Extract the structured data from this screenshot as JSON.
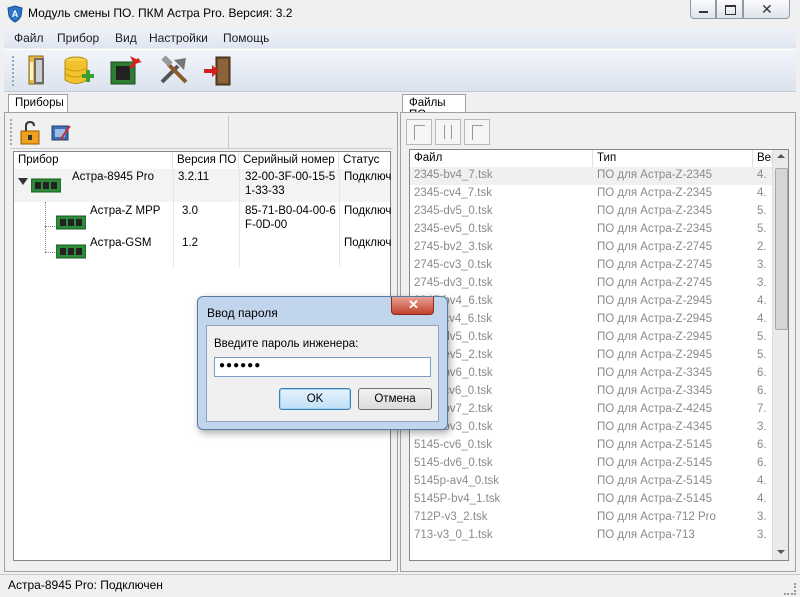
{
  "window": {
    "title": "Модуль смены ПО. ПКМ Астра Pro. Версия: 3.2"
  },
  "menu": [
    "Файл",
    "Прибор",
    "Вид",
    "Настройки",
    "Помощь"
  ],
  "toolbar": {
    "icons": [
      "open-folder-icon",
      "add-database-icon",
      "chip-download-icon",
      "tools-icon",
      "exit-icon"
    ]
  },
  "left_panel": {
    "tab": "Приборы",
    "icons": [
      "lock-icon",
      "chip-pencil-icon"
    ],
    "columns": [
      "Прибор",
      "Версия ПО",
      "Серийный номер",
      "Статус"
    ],
    "devices": [
      {
        "name": "Астра-8945 Pro",
        "version": "3.2.11",
        "serial_l1": "32-00-3F-00-15-5",
        "serial_l2": "1-33-33",
        "status": "Подключ"
      },
      {
        "name": "Астра-Z МРР",
        "version": "3.0",
        "serial_l1": "85-71-B0-04-00-6",
        "serial_l2": "F-0D-00",
        "status": "Подключ"
      },
      {
        "name": "Астра-GSM",
        "version": "1.2",
        "serial_l1": "",
        "serial_l2": "",
        "status": "Подключ"
      }
    ]
  },
  "right_panel": {
    "tab": "Файлы ПО",
    "columns": [
      "Файл",
      "Тип",
      "Верси"
    ],
    "files": [
      {
        "file": "2345-bv4_7.tsk",
        "type": "ПО для Астра-Z-2345",
        "ver": "4."
      },
      {
        "file": "2345-cv4_7.tsk",
        "type": "ПО для Астра-Z-2345",
        "ver": "4."
      },
      {
        "file": "2345-dv5_0.tsk",
        "type": "ПО для Астра-Z-2345",
        "ver": "5."
      },
      {
        "file": "2345-ev5_0.tsk",
        "type": "ПО для Астра-Z-2345",
        "ver": "5."
      },
      {
        "file": "2745-bv2_3.tsk",
        "type": "ПО для Астра-Z-2745",
        "ver": "2."
      },
      {
        "file": "2745-cv3_0.tsk",
        "type": "ПО для Астра-Z-2745",
        "ver": "3."
      },
      {
        "file": "2745-dv3_0.tsk",
        "type": "ПО для Астра-Z-2745",
        "ver": "3."
      },
      {
        "file": "2945-bv4_6.tsk",
        "type": "ПО для Астра-Z-2945",
        "ver": "4."
      },
      {
        "file": "2945-cv4_6.tsk",
        "type": "ПО для Астра-Z-2945",
        "ver": "4."
      },
      {
        "file": "2945-dv5_0.tsk",
        "type": "ПО для Астра-Z-2945",
        "ver": "5."
      },
      {
        "file": "2945-ev5_2.tsk",
        "type": "ПО для Астра-Z-2945",
        "ver": "5."
      },
      {
        "file": "3345-bv6_0.tsk",
        "type": "ПО для Астра-Z-3345",
        "ver": "6."
      },
      {
        "file": "3345-cv6_0.tsk",
        "type": "ПО для Астра-Z-3345",
        "ver": "6."
      },
      {
        "file": "4245-bv7_2.tsk",
        "type": "ПО для Астра-Z-4245",
        "ver": "7."
      },
      {
        "file": "4345-bv3_0.tsk",
        "type": "ПО для Астра-Z-4345",
        "ver": "3."
      },
      {
        "file": "5145-cv6_0.tsk",
        "type": "ПО для Астра-Z-5145",
        "ver": "6."
      },
      {
        "file": "5145-dv6_0.tsk",
        "type": "ПО для Астра-Z-5145",
        "ver": "6."
      },
      {
        "file": "5145p-av4_0.tsk",
        "type": "ПО для Астра-Z-5145",
        "ver": "4."
      },
      {
        "file": "5145P-bv4_1.tsk",
        "type": "ПО для Астра-Z-5145",
        "ver": "4."
      },
      {
        "file": "712P-v3_2.tsk",
        "type": "ПО для Астра-712 Pro",
        "ver": "3."
      },
      {
        "file": "713-v3_0_1.tsk",
        "type": "ПО для Астра-713",
        "ver": "3."
      }
    ]
  },
  "dialog": {
    "title": "Ввод пароля",
    "prompt": "Введите пароль инженера:",
    "password": "●●●●●●",
    "ok": "OK",
    "cancel": "Отмена"
  },
  "status": "Астра-8945 Pro: Подключен"
}
